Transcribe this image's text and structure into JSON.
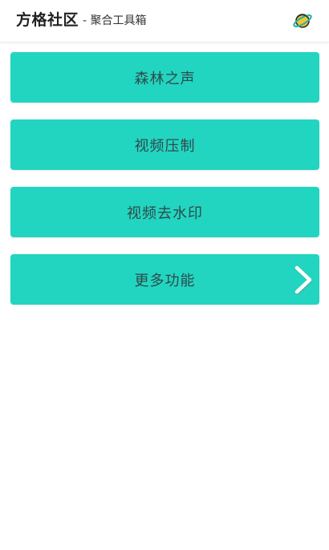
{
  "header": {
    "title": "方格社区",
    "subtitle": "- 聚合工具箱",
    "icon": "planet-icon"
  },
  "menu": {
    "items": [
      {
        "label": "森林之声"
      },
      {
        "label": "视频压制"
      },
      {
        "label": "视频去水印"
      },
      {
        "label": "更多功能",
        "icon": "chevron-right-icon"
      }
    ]
  },
  "colors": {
    "accent": "#22d5c1",
    "button_text": "#2f4a4a",
    "header_bg": "#ffffff",
    "planet_body": "#f4c430",
    "planet_ring": "#2bb3a3"
  }
}
